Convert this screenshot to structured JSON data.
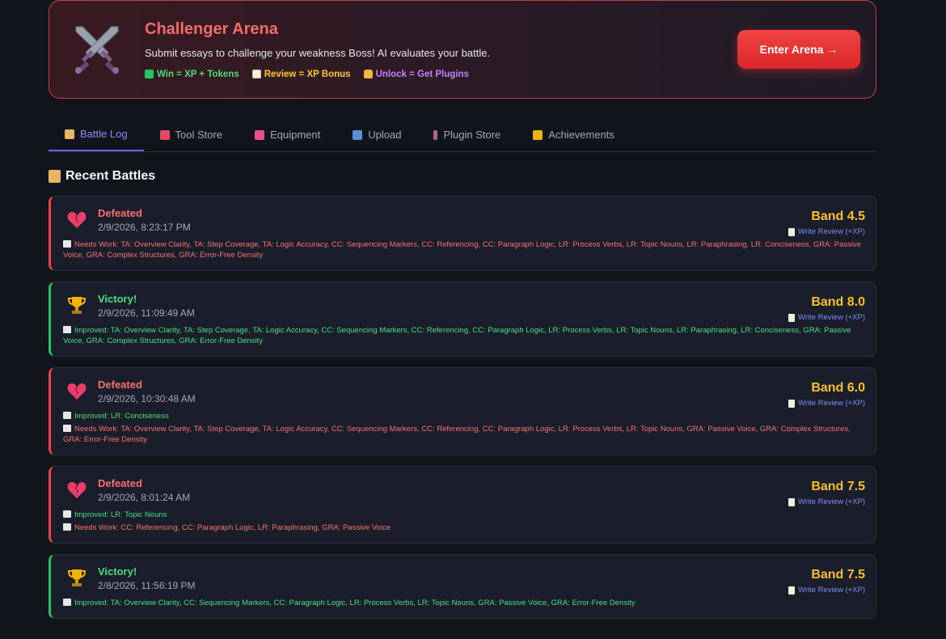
{
  "hero": {
    "title": "Challenger Arena",
    "subtitle": "Submit essays to challenge your weakness Boss! AI evaluates your battle.",
    "badges": {
      "win": "Win = XP + Tokens",
      "review": "Review = XP Bonus",
      "unlock": "Unlock = Get Plugins"
    },
    "enter_button": "Enter Arena →"
  },
  "tabs": {
    "battle_log": "Battle Log",
    "tool_store": "Tool Store",
    "equipment": "Equipment",
    "upload": "Upload",
    "plugin_store": "Plugin Store",
    "achievements": "Achievements"
  },
  "section_title": "Recent Battles",
  "review_label": "Write Review (+XP)",
  "battles": [
    {
      "status": "Defeated",
      "date": "2/9/2026, 8:23:17 PM",
      "band": "Band 4.5",
      "needs_work": "Needs Work: TA: Overview Clarity, TA: Step Coverage, TA: Logic Accuracy, CC: Sequencing Markers, CC: Referencing, CC: Paragraph Logic, LR: Process Verbs, LR: Topic Nouns, LR: Paraphrasing, LR: Conciseness, GRA: Passive Voice, GRA: Complex Structures, GRA: Error-Free Density"
    },
    {
      "status": "Victory!",
      "date": "2/9/2026, 11:09:49 AM",
      "band": "Band 8.0",
      "improved": "Improved: TA: Overview Clarity, TA: Step Coverage, TA: Logic Accuracy, CC: Sequencing Markers, CC: Referencing, CC: Paragraph Logic, LR: Process Verbs, LR: Topic Nouns, LR: Paraphrasing, LR: Conciseness, GRA: Passive Voice, GRA: Complex Structures, GRA: Error-Free Density"
    },
    {
      "status": "Defeated",
      "date": "2/9/2026, 10:30:48 AM",
      "band": "Band 6.0",
      "improved": "Improved: LR: Conciseness",
      "needs_work": "Needs Work: TA: Overview Clarity, TA: Step Coverage, TA: Logic Accuracy, CC: Sequencing Markers, CC: Referencing, CC: Paragraph Logic, LR: Process Verbs, LR: Topic Nouns, GRA: Passive Voice, GRA: Complex Structures, GRA: Error-Free Density"
    },
    {
      "status": "Defeated",
      "date": "2/9/2026, 8:01:24 AM",
      "band": "Band 7.5",
      "improved": "Improved: LR: Topic Nouns",
      "needs_work": "Needs Work: CC: Referencing, CC: Paragraph Logic, LR: Paraphrasing, GRA: Passive Voice"
    },
    {
      "status": "Victory!",
      "date": "2/8/2026, 11:56:19 PM",
      "band": "Band 7.5",
      "improved": "Improved: TA: Overview Clarity, CC: Sequencing Markers, CC: Paragraph Logic, LR: Process Verbs, LR: Topic Nouns, GRA: Passive Voice, GRA: Error-Free Density"
    }
  ],
  "icons": {
    "hero": "crossed-swords-icon",
    "defeated": "broken-heart-icon",
    "victory": "trophy-icon"
  },
  "colors": {
    "accent_red": "#ef4444",
    "victory_green": "#22c55e",
    "band_gold": "#fbbf24",
    "tab_active": "#818cf8",
    "background": "#12141c"
  }
}
